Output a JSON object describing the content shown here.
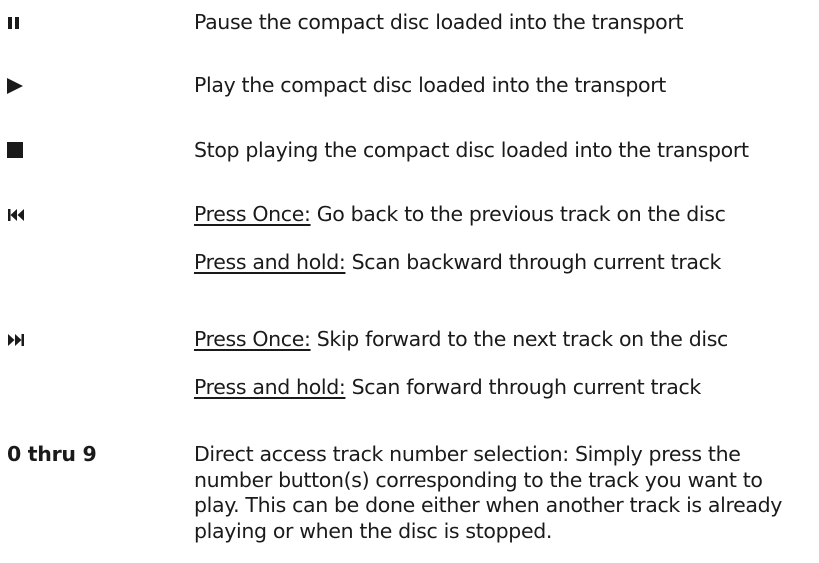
{
  "rows": {
    "pause": {
      "icon": "pause-icon",
      "desc": "Pause the compact disc loaded into the transport"
    },
    "play": {
      "icon": "play-icon",
      "desc": "Play the compact disc loaded into the transport"
    },
    "stop": {
      "icon": "stop-icon",
      "desc": "Stop playing the compact disc loaded into the transport"
    },
    "previous": {
      "icon": "skip-previous-icon",
      "once_label": "Press Once:",
      "once_text": " Go back to the previous track on the disc",
      "hold_label": "Press and hold:",
      "hold_text": "  Scan backward through current track"
    },
    "next": {
      "icon": "skip-next-icon",
      "once_label": "Press Once:",
      "once_text": "  Skip forward to the next track on the disc",
      "hold_label": "Press and hold:",
      "hold_text": "  Scan forward through current track"
    },
    "digits": {
      "label": "0 thru 9",
      "desc": "Direct access track number selection:  Simply press the number button(s) corresponding to the track you want to play. This can be done either when another track is already playing or when the disc is stopped."
    }
  }
}
